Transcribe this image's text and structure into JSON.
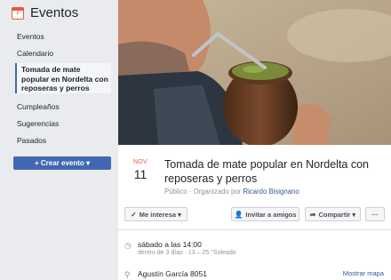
{
  "sidebar": {
    "icon_day": "7",
    "title": "Eventos",
    "items": [
      {
        "label": "Eventos"
      },
      {
        "label": "Calendario"
      },
      {
        "label": "Cumpleaños"
      },
      {
        "label": "Sugerencias"
      },
      {
        "label": "Pasados"
      }
    ],
    "active": {
      "line1": "Tomada de mate",
      "line2": "popular en Nordelta con",
      "line3": "reposeras y perros"
    },
    "create_button": "+ Crear evento ▾"
  },
  "event": {
    "month": "NOV",
    "day": "11",
    "title": "Tomada de mate popular en Nordelta con reposeras y perros",
    "privacy": "Público",
    "organizer_prefix": "Organizado por",
    "organizer": "Ricardo Bisignano",
    "actions": {
      "interested": "Me interesa ▾",
      "invite": "Invitar a amigos",
      "share": "Compartir ▾",
      "more": "···"
    },
    "when": {
      "text": "sábado a las 14:00",
      "detail": "dentro de 3 días · 13 – 25 °Soleado"
    },
    "where": {
      "text": "Agustín García 8051",
      "map_link": "Mostrar mapa"
    }
  },
  "colors": {
    "accent": "#4267b2",
    "date_red": "#e9573f",
    "link": "#365899"
  }
}
